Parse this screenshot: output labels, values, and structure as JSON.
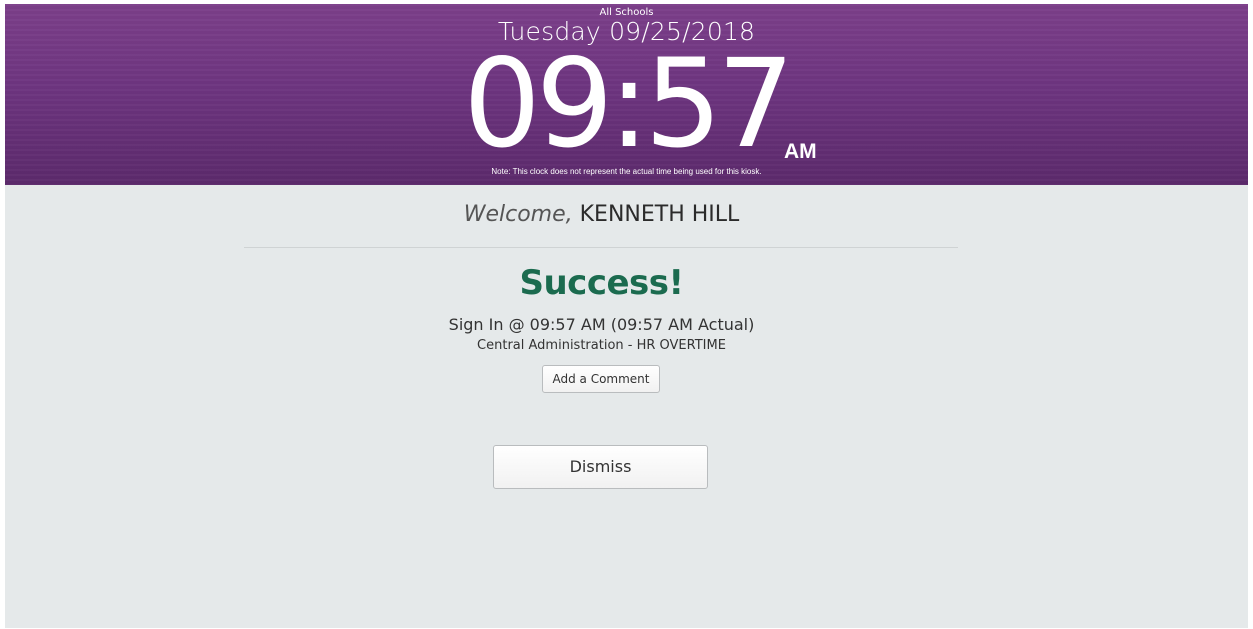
{
  "header": {
    "location": "All Schools",
    "date": "Tuesday 09/25/2018",
    "time": "09:57",
    "ampm": "AM",
    "note": "Note: This clock does not represent the actual time being used for this kiosk.",
    "colors": {
      "top": "#7c3f8a",
      "bottom": "#5c2a6c"
    }
  },
  "welcome": {
    "greeting": "Welcome,",
    "name": "KENNETH HILL"
  },
  "result": {
    "status": "Success!",
    "sign_in": "Sign In @ 09:57 AM (09:57 AM Actual)",
    "location": "Central Administration - HR OVERTIME",
    "status_color": "#1b6b4f"
  },
  "actions": {
    "add_comment": "Add a Comment",
    "dismiss": "Dismiss"
  }
}
